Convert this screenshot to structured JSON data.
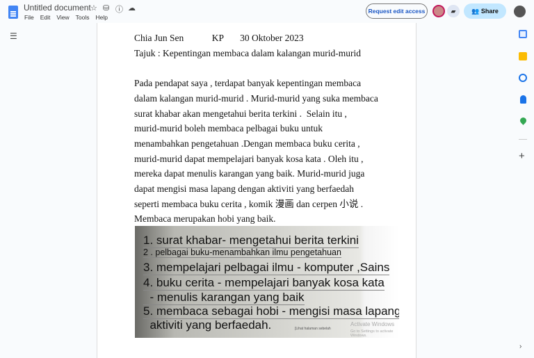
{
  "header": {
    "title": "Untitled document",
    "menu": [
      "File",
      "Edit",
      "View",
      "Tools",
      "Help"
    ],
    "request_edit": "Request edit access",
    "share": "Share"
  },
  "document": {
    "lines": [
      "Chia Jun Sen            KP       30 Oktober 2023",
      "Tajuk : Kepentingan membaca dalam kalangan murid-murid",
      "",
      "Pada pendapat saya , terdapat banyak kepentingan membaca",
      "dalam kalangan murid-murid . Murid-murid yang suka membaca",
      "surat khabar akan mengetahui berita terkini .  Selain itu ,",
      "murid-murid boleh membaca pelbagai buku untuk",
      "menambahkan pengetahuan .Dengan membaca buku cerita ,",
      "murid-murid dapat mempelajari banyak kosa kata . Oleh itu ,",
      "mereka dapat menulis karangan yang baik. Murid-murid juga",
      "dapat mengisi masa lapang dengan aktiviti yang berfaedah",
      "seperti membaca buku cerita , komik 漫画 dan cerpen 小说 .",
      "Membaca merupakan hobi yang baik."
    ]
  },
  "image": {
    "lines": [
      "1. surat khabar- mengetahui berita terkini",
      "2 . pelbagai buku-menambahkan ilmu pengetahuan",
      "3. mempelajari pelbagai ilmu - komputer ,Sains",
      "4. buku cerita - mempelajari banyak kosa kata",
      "  - menulis karangan yang baik",
      "5. membaca sebagai hobi - mengisi masa lapang",
      "  aktiviti yang berfaedah."
    ],
    "footnote": "[Lihat halaman sebelah",
    "activate_title": "Activate Windows",
    "activate_sub": "Go to Settings to activate Windows."
  }
}
